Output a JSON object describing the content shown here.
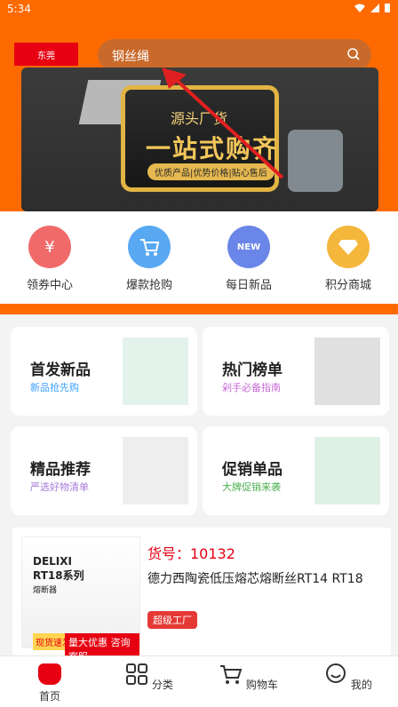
{
  "status": {
    "time": "5:34"
  },
  "header": {
    "logo_text": "东莞",
    "search_text": "钢丝绳"
  },
  "banner": {
    "line1": "源头厂货",
    "line2": "一站式购齐",
    "line3": "优质产品|优势价格|贴心售后"
  },
  "shortcuts": [
    {
      "label": "领券中心",
      "icon": "coupon-icon",
      "color": "#f06a6a"
    },
    {
      "label": "爆款抢购",
      "icon": "cart-icon",
      "color": "#58a8f2"
    },
    {
      "label": "每日新品",
      "icon": "calendar-new-icon",
      "color": "#6a86e8"
    },
    {
      "label": "积分商城",
      "icon": "diamond-icon",
      "color": "#f4b63b"
    }
  ],
  "cards": [
    {
      "title": "首发新品",
      "subtitle": "新品抢先购",
      "subtitle_color": "#3aa0ff"
    },
    {
      "title": "热门榜单",
      "subtitle": "剁手必备指南",
      "subtitle_color": "#c86bd6"
    },
    {
      "title": "精品推荐",
      "subtitle": "严选好物清单",
      "subtitle_color": "#a77ad9"
    },
    {
      "title": "促销单品",
      "subtitle": "大牌促销来袭",
      "subtitle_color": "#4caf50"
    }
  ],
  "product": {
    "code": "货号：10132",
    "name": "德力西陶瓷低压熔芯熔断丝RT14 RT18",
    "badge": "超级工厂",
    "image_brand": "DELIXI",
    "image_series": "RT18系列",
    "image_type": "熔断器",
    "image_tag1": "现货速发",
    "image_tag2": "量大优惠 咨询客服"
  },
  "tabs": [
    {
      "label": "首页",
      "icon": "home-icon"
    },
    {
      "label": "分类",
      "icon": "grid-icon"
    },
    {
      "label": "购物车",
      "icon": "cart-icon"
    },
    {
      "label": "我的",
      "icon": "user-icon"
    }
  ],
  "colors": {
    "brand_orange": "#ff6a00",
    "brand_red": "#e60012"
  }
}
